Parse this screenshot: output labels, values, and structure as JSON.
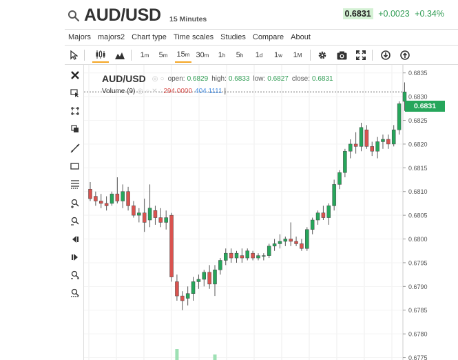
{
  "header": {
    "symbol": "AUD/USD",
    "interval": "15 Minutes",
    "last_price": "0.6831",
    "change": "+0.0023",
    "change_pct": "+0.34%"
  },
  "menu": [
    "Majors",
    "majors2",
    "Chart type",
    "Time scales",
    "Studies",
    "Compare",
    "About"
  ],
  "toolbar": {
    "intervals": [
      {
        "main": "1",
        "sup": "m"
      },
      {
        "main": "5",
        "sup": "m"
      },
      {
        "main": "15",
        "sup": "m"
      },
      {
        "main": "30",
        "sup": "m"
      },
      {
        "main": "1",
        "sup": "h"
      },
      {
        "main": "5",
        "sup": "h"
      },
      {
        "main": "1",
        "sup": "d"
      },
      {
        "main": "1",
        "sup": "w"
      },
      {
        "main": "1",
        "sup": "M"
      }
    ],
    "active_interval": "15m"
  },
  "legend": {
    "symbol": "AUD/USD",
    "open_label": "open:",
    "open": "0.6829",
    "high_label": "high:",
    "high": "0.6833",
    "low_label": "low:",
    "low": "0.6827",
    "close_label": "close:",
    "close": "0.6831",
    "volume_label": "Volume (9)",
    "volume_sep": ":",
    "volume_1": "294.0000",
    "volume_2": "404.1111",
    "volume_end": "|"
  },
  "price_tag": "0.6831",
  "colors": {
    "up": "#26a65b",
    "down": "#d9534f",
    "accent": "#f5a623"
  },
  "chart_data": {
    "type": "candlestick",
    "y_ticks": [
      "0.6835",
      "0.6830",
      "0.6825",
      "0.6820",
      "0.6815",
      "0.6810",
      "0.6805",
      "0.6800",
      "0.6795",
      "0.6790",
      "0.6785",
      "0.6780",
      "0.6775"
    ],
    "ylim": [
      0.67745,
      0.68367
    ],
    "last_price": 0.6831,
    "candles": [
      {
        "o": 0.68105,
        "h": 0.6812,
        "l": 0.6808,
        "c": 0.68085
      },
      {
        "o": 0.6809,
        "h": 0.681,
        "l": 0.6807,
        "c": 0.6808
      },
      {
        "o": 0.6808,
        "h": 0.68095,
        "l": 0.68065,
        "c": 0.68075
      },
      {
        "o": 0.68075,
        "h": 0.6809,
        "l": 0.6806,
        "c": 0.6807
      },
      {
        "o": 0.68075,
        "h": 0.681,
        "l": 0.6807,
        "c": 0.68095
      },
      {
        "o": 0.68095,
        "h": 0.6813,
        "l": 0.68075,
        "c": 0.6808
      },
      {
        "o": 0.6808,
        "h": 0.68115,
        "l": 0.68065,
        "c": 0.681
      },
      {
        "o": 0.681,
        "h": 0.6811,
        "l": 0.6806,
        "c": 0.6807
      },
      {
        "o": 0.6807,
        "h": 0.6808,
        "l": 0.68045,
        "c": 0.6805
      },
      {
        "o": 0.6805,
        "h": 0.68065,
        "l": 0.68035,
        "c": 0.68055
      },
      {
        "o": 0.68055,
        "h": 0.68085,
        "l": 0.68015,
        "c": 0.68035
      },
      {
        "o": 0.6804,
        "h": 0.68115,
        "l": 0.68025,
        "c": 0.68065
      },
      {
        "o": 0.6806,
        "h": 0.6807,
        "l": 0.6803,
        "c": 0.68045
      },
      {
        "o": 0.68045,
        "h": 0.68065,
        "l": 0.68025,
        "c": 0.68035
      },
      {
        "o": 0.68035,
        "h": 0.6806,
        "l": 0.6802,
        "c": 0.68045
      },
      {
        "o": 0.6805,
        "h": 0.68055,
        "l": 0.6791,
        "c": 0.6792
      },
      {
        "o": 0.6791,
        "h": 0.67925,
        "l": 0.6787,
        "c": 0.6788
      },
      {
        "o": 0.6788,
        "h": 0.6789,
        "l": 0.6785,
        "c": 0.6787
      },
      {
        "o": 0.67875,
        "h": 0.679,
        "l": 0.6786,
        "c": 0.67885
      },
      {
        "o": 0.67885,
        "h": 0.6792,
        "l": 0.6787,
        "c": 0.6791
      },
      {
        "o": 0.6791,
        "h": 0.67925,
        "l": 0.67895,
        "c": 0.67915
      },
      {
        "o": 0.67915,
        "h": 0.67935,
        "l": 0.679,
        "c": 0.6793
      },
      {
        "o": 0.6793,
        "h": 0.67945,
        "l": 0.67895,
        "c": 0.67905
      },
      {
        "o": 0.67905,
        "h": 0.67945,
        "l": 0.6788,
        "c": 0.67935
      },
      {
        "o": 0.67935,
        "h": 0.6796,
        "l": 0.67925,
        "c": 0.67955
      },
      {
        "o": 0.67955,
        "h": 0.6798,
        "l": 0.67945,
        "c": 0.6797
      },
      {
        "o": 0.6797,
        "h": 0.6798,
        "l": 0.6795,
        "c": 0.6796
      },
      {
        "o": 0.6796,
        "h": 0.67975,
        "l": 0.6795,
        "c": 0.6797
      },
      {
        "o": 0.67965,
        "h": 0.6798,
        "l": 0.6795,
        "c": 0.6796
      },
      {
        "o": 0.6796,
        "h": 0.6798,
        "l": 0.67955,
        "c": 0.67975
      },
      {
        "o": 0.6797,
        "h": 0.67975,
        "l": 0.67955,
        "c": 0.6796
      },
      {
        "o": 0.6796,
        "h": 0.6797,
        "l": 0.67955,
        "c": 0.67965
      },
      {
        "o": 0.67965,
        "h": 0.6797,
        "l": 0.67955,
        "c": 0.67965
      },
      {
        "o": 0.67965,
        "h": 0.6799,
        "l": 0.6796,
        "c": 0.67985
      },
      {
        "o": 0.67985,
        "h": 0.68,
        "l": 0.67975,
        "c": 0.6799
      },
      {
        "o": 0.6799,
        "h": 0.6801,
        "l": 0.6798,
        "c": 0.67995
      },
      {
        "o": 0.67995,
        "h": 0.68005,
        "l": 0.67985,
        "c": 0.68
      },
      {
        "o": 0.68,
        "h": 0.68035,
        "l": 0.67985,
        "c": 0.67995
      },
      {
        "o": 0.67995,
        "h": 0.68005,
        "l": 0.67985,
        "c": 0.6799
      },
      {
        "o": 0.6799,
        "h": 0.68,
        "l": 0.67975,
        "c": 0.6798
      },
      {
        "o": 0.6798,
        "h": 0.68025,
        "l": 0.67975,
        "c": 0.6802
      },
      {
        "o": 0.6802,
        "h": 0.68045,
        "l": 0.6801,
        "c": 0.6804
      },
      {
        "o": 0.6804,
        "h": 0.6806,
        "l": 0.6803,
        "c": 0.68055
      },
      {
        "o": 0.68055,
        "h": 0.6807,
        "l": 0.6804,
        "c": 0.68045
      },
      {
        "o": 0.68045,
        "h": 0.68075,
        "l": 0.6803,
        "c": 0.6807
      },
      {
        "o": 0.6807,
        "h": 0.68125,
        "l": 0.6806,
        "c": 0.68115
      },
      {
        "o": 0.68115,
        "h": 0.68145,
        "l": 0.68105,
        "c": 0.6814
      },
      {
        "o": 0.6814,
        "h": 0.6819,
        "l": 0.6813,
        "c": 0.68185
      },
      {
        "o": 0.68185,
        "h": 0.6821,
        "l": 0.6817,
        "c": 0.682
      },
      {
        "o": 0.682,
        "h": 0.68225,
        "l": 0.6818,
        "c": 0.68195
      },
      {
        "o": 0.68195,
        "h": 0.68245,
        "l": 0.68185,
        "c": 0.68235
      },
      {
        "o": 0.6823,
        "h": 0.6824,
        "l": 0.6819,
        "c": 0.68195
      },
      {
        "o": 0.68195,
        "h": 0.68205,
        "l": 0.68175,
        "c": 0.68185
      },
      {
        "o": 0.68185,
        "h": 0.68215,
        "l": 0.6817,
        "c": 0.68205
      },
      {
        "o": 0.68205,
        "h": 0.6822,
        "l": 0.6819,
        "c": 0.6821
      },
      {
        "o": 0.6821,
        "h": 0.6822,
        "l": 0.6819,
        "c": 0.682
      },
      {
        "o": 0.682,
        "h": 0.6824,
        "l": 0.68195,
        "c": 0.6823
      },
      {
        "o": 0.6823,
        "h": 0.6829,
        "l": 0.6822,
        "c": 0.68285
      },
      {
        "o": 0.6829,
        "h": 0.6833,
        "l": 0.6827,
        "c": 0.6831
      }
    ],
    "volume_visible": [
      {
        "index": 16,
        "value": 1.0,
        "color": "up"
      },
      {
        "index": 23,
        "value": 0.5,
        "color": "up"
      }
    ]
  }
}
